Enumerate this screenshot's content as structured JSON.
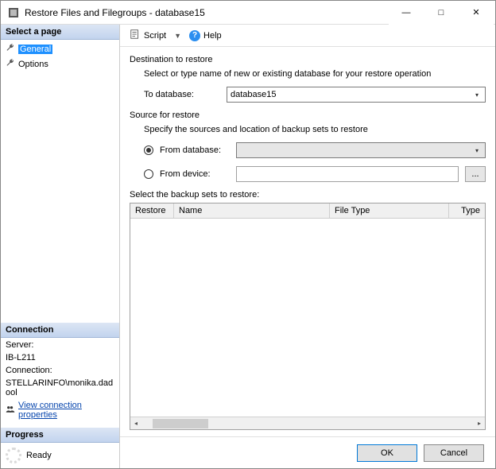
{
  "window": {
    "title": "Restore Files and Filegroups - database15"
  },
  "sidebar": {
    "select_page_header": "Select a page",
    "items": [
      {
        "label": "General",
        "selected": true
      },
      {
        "label": "Options",
        "selected": false
      }
    ],
    "connection_header": "Connection",
    "server_label": "Server:",
    "server_value": "IB-L211",
    "connection_label": "Connection:",
    "connection_value": "STELLARINFO\\monika.dadool",
    "view_conn_props": "View connection properties",
    "progress_header": "Progress",
    "progress_status": "Ready"
  },
  "toolbar": {
    "script_label": "Script",
    "help_label": "Help"
  },
  "content": {
    "dest_section": "Destination to restore",
    "dest_desc": "Select or type name of new or existing database for your restore operation",
    "to_db_label": "To database:",
    "to_db_value": "database15",
    "source_section": "Source for restore",
    "source_desc": "Specify the sources and location of backup sets to restore",
    "from_db_label": "From database:",
    "from_device_label": "From device:",
    "browse_label": "...",
    "grid_title": "Select the backup sets to restore:",
    "columns": {
      "restore": "Restore",
      "name": "Name",
      "filetype": "File Type",
      "type": "Type"
    }
  },
  "footer": {
    "ok": "OK",
    "cancel": "Cancel"
  }
}
